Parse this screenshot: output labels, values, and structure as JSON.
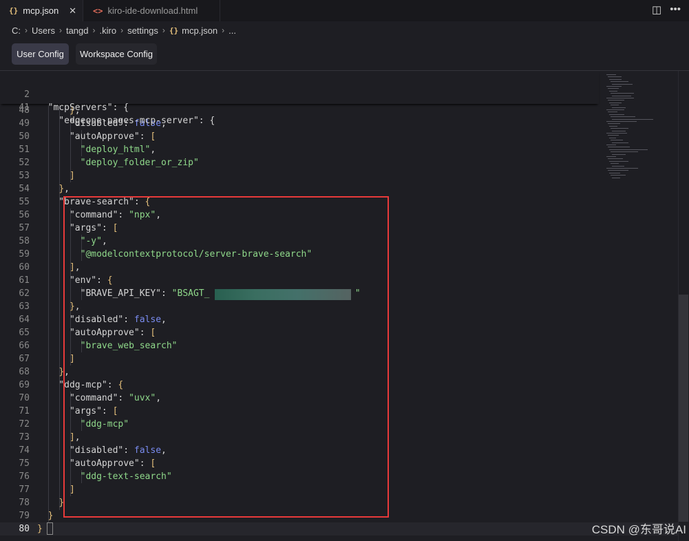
{
  "tabs": [
    {
      "label": "mcp.json",
      "icon": "json-braces-icon",
      "active": true
    },
    {
      "label": "kiro-ide-download.html",
      "icon": "html-code-icon",
      "active": false
    }
  ],
  "tab_close": "✕",
  "tab_actions": {
    "split": "◫",
    "more": "•••"
  },
  "breadcrumb": [
    "C:",
    "Users",
    "tangd",
    ".kiro",
    "settings",
    "mcp.json",
    "..."
  ],
  "config_buttons": {
    "user": "User Config",
    "workspace": "Workspace Config"
  },
  "sticky_lines": [
    {
      "n": "2",
      "code": "  \"mcpServers\": {"
    },
    {
      "n": "41",
      "code": "    \"edgeone-pages-mcp-server\": {"
    }
  ],
  "lines": [
    {
      "n": "48",
      "html": "      <span class=\"p\">}</span>,"
    },
    {
      "n": "49",
      "html": "      \"disabled\": <span class=\"b\">false</span>,"
    },
    {
      "n": "50",
      "html": "      \"autoApprove\": <span class=\"p\">[</span>"
    },
    {
      "n": "51",
      "html": "        <span class=\"s\">\"deploy_html\"</span>,"
    },
    {
      "n": "52",
      "html": "        <span class=\"s\">\"deploy_folder_or_zip\"</span>"
    },
    {
      "n": "53",
      "html": "      <span class=\"p\">]</span>"
    },
    {
      "n": "54",
      "html": "    <span class=\"p\">}</span>,"
    },
    {
      "n": "55",
      "html": "    \"brave-search\": <span class=\"p\">{</span>"
    },
    {
      "n": "56",
      "html": "      \"command\": <span class=\"s\">\"npx\"</span>,"
    },
    {
      "n": "57",
      "html": "      \"args\": <span class=\"p\">[</span>"
    },
    {
      "n": "58",
      "html": "        <span class=\"s\">\"-y\"</span>,"
    },
    {
      "n": "59",
      "html": "        <span class=\"s\">\"@modelcontextprotocol/server-brave-search\"</span>"
    },
    {
      "n": "60",
      "html": "      <span class=\"p\">]</span>,"
    },
    {
      "n": "61",
      "html": "      \"env\": <span class=\"p\">{</span>"
    },
    {
      "n": "62",
      "html": "        \"BRAVE_API_KEY\": <span class=\"s\">\"BSAGT_                           \"</span>"
    },
    {
      "n": "63",
      "html": "      <span class=\"p\">}</span>,"
    },
    {
      "n": "64",
      "html": "      \"disabled\": <span class=\"b\">false</span>,"
    },
    {
      "n": "65",
      "html": "      \"autoApprove\": <span class=\"p\">[</span>"
    },
    {
      "n": "66",
      "html": "        <span class=\"s\">\"brave_web_search\"</span>"
    },
    {
      "n": "67",
      "html": "      <span class=\"p\">]</span>"
    },
    {
      "n": "68",
      "html": "    <span class=\"p\">}</span>,"
    },
    {
      "n": "69",
      "html": "    \"ddg-mcp\": <span class=\"p\">{</span>"
    },
    {
      "n": "70",
      "html": "      \"command\": <span class=\"s\">\"uvx\"</span>,"
    },
    {
      "n": "71",
      "html": "      \"args\": <span class=\"p\">[</span>"
    },
    {
      "n": "72",
      "html": "        <span class=\"s\">\"ddg-mcp\"</span>"
    },
    {
      "n": "73",
      "html": "      <span class=\"p\">]</span>,"
    },
    {
      "n": "74",
      "html": "      \"disabled\": <span class=\"b\">false</span>,"
    },
    {
      "n": "75",
      "html": "      \"autoApprove\": <span class=\"p\">[</span>"
    },
    {
      "n": "76",
      "html": "        <span class=\"s\">\"ddg-text-search\"</span>"
    },
    {
      "n": "77",
      "html": "      <span class=\"p\">]</span>"
    },
    {
      "n": "78",
      "html": "    <span class=\"p\">}</span>"
    },
    {
      "n": "79",
      "html": "  <span class=\"p\">}</span>"
    },
    {
      "n": "80",
      "html": "<span class=\"p\">}</span>"
    }
  ],
  "current_line": "80",
  "watermark": "CSDN @东哥说AI",
  "colors": {
    "highlight_box": "#e83a3a",
    "string": "#8fd88a",
    "boolean": "#7a8cf0",
    "bracket": "#e5c07b"
  }
}
